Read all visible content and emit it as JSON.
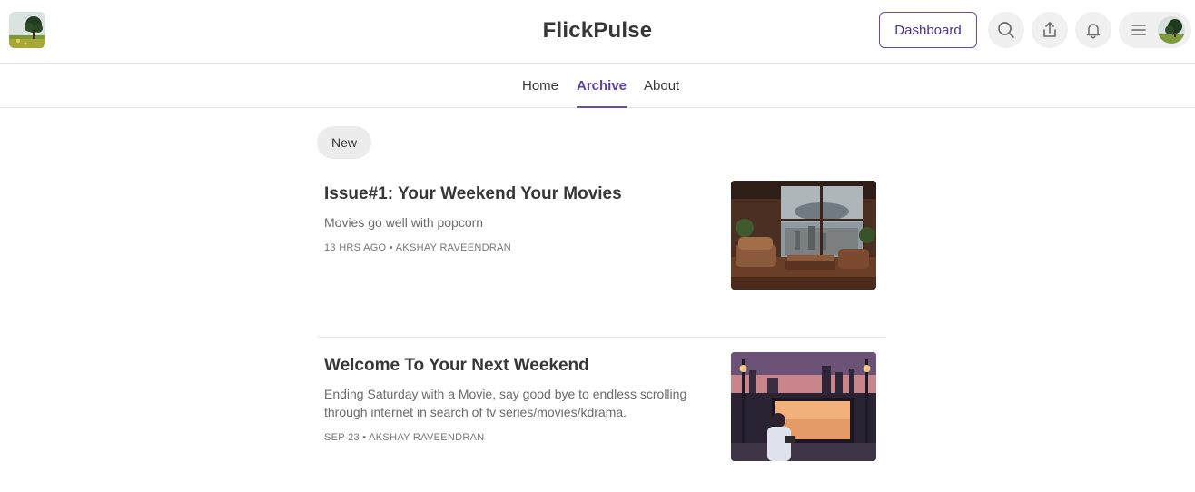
{
  "header": {
    "brand": "FlickPulse",
    "dashboard_label": "Dashboard",
    "icons": [
      "search-icon",
      "share-icon",
      "bell-icon",
      "menu-icon"
    ]
  },
  "nav": {
    "items": [
      {
        "label": "Home",
        "active": false
      },
      {
        "label": "Archive",
        "active": true
      },
      {
        "label": "About",
        "active": false
      }
    ]
  },
  "filter": {
    "chip_label": "New"
  },
  "posts": [
    {
      "title": "Issue#1: Your Weekend Your Movies",
      "subtitle": "Movies go well with popcorn",
      "meta": "13 HRS AGO • AKSHAY RAVEENDRAN"
    },
    {
      "title": "Welcome To Your Next Weekend",
      "subtitle": "Ending Saturday with a Movie, say good bye to endless scrolling through internet in search of tv series/movies/kdrama.",
      "meta": "SEP 23 • AKSHAY RAVEENDRAN"
    }
  ],
  "colors": {
    "accent": "#6a4ba8",
    "text": "#363737",
    "muted": "#6b6b6b",
    "pill_bg": "#f0f0f0"
  }
}
